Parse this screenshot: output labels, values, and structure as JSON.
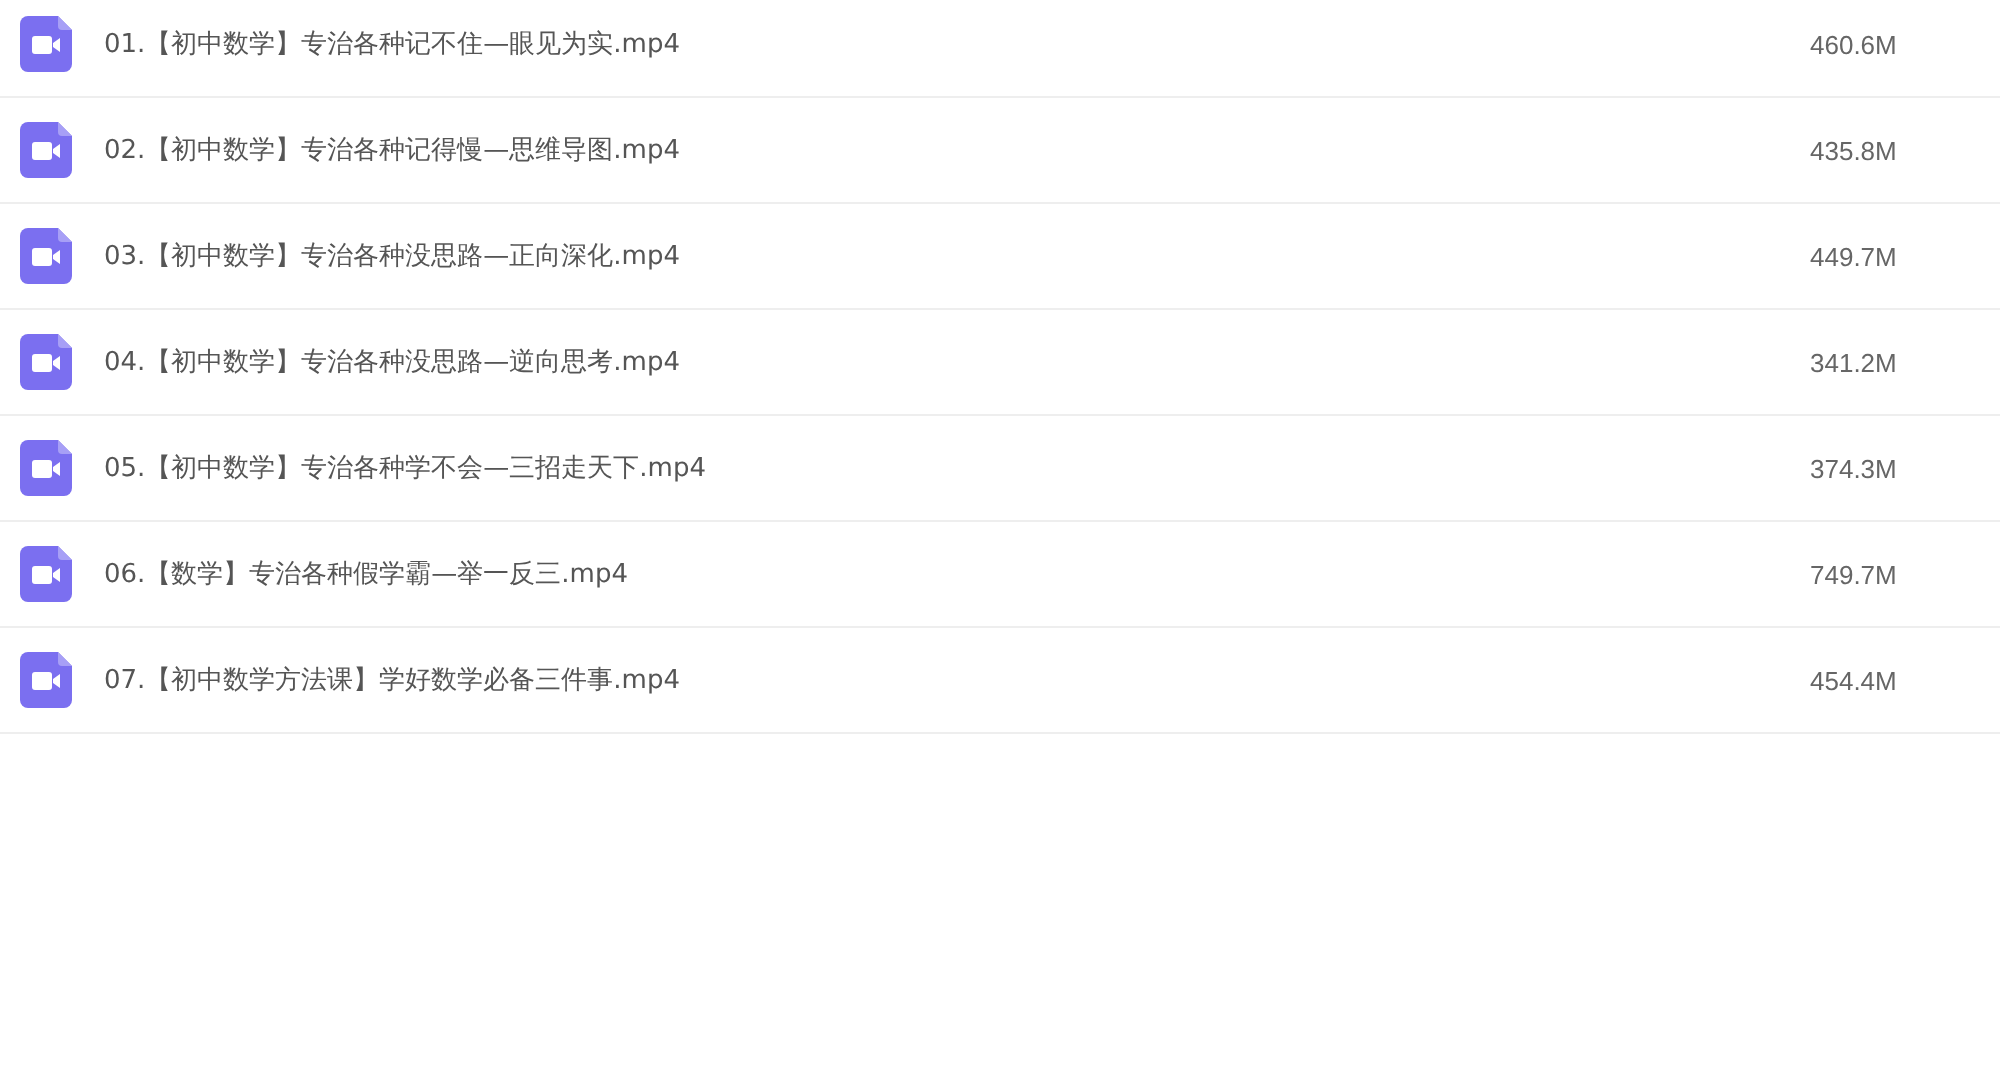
{
  "files": [
    {
      "name": "01.【初中数学】专治各种记不住—眼见为实.mp4",
      "size": "460.6M"
    },
    {
      "name": "02.【初中数学】专治各种记得慢—思维导图.mp4",
      "size": "435.8M"
    },
    {
      "name": "03.【初中数学】专治各种没思路—正向深化.mp4",
      "size": "449.7M"
    },
    {
      "name": "04.【初中数学】专治各种没思路—逆向思考.mp4",
      "size": "341.2M"
    },
    {
      "name": "05.【初中数学】专治各种学不会—三招走天下.mp4",
      "size": "374.3M"
    },
    {
      "name": "06.【数学】专治各种假学霸—举一反三.mp4",
      "size": "749.7M"
    },
    {
      "name": "07.【初中数学方法课】学好数学必备三件事.mp4",
      "size": "454.4M"
    }
  ]
}
